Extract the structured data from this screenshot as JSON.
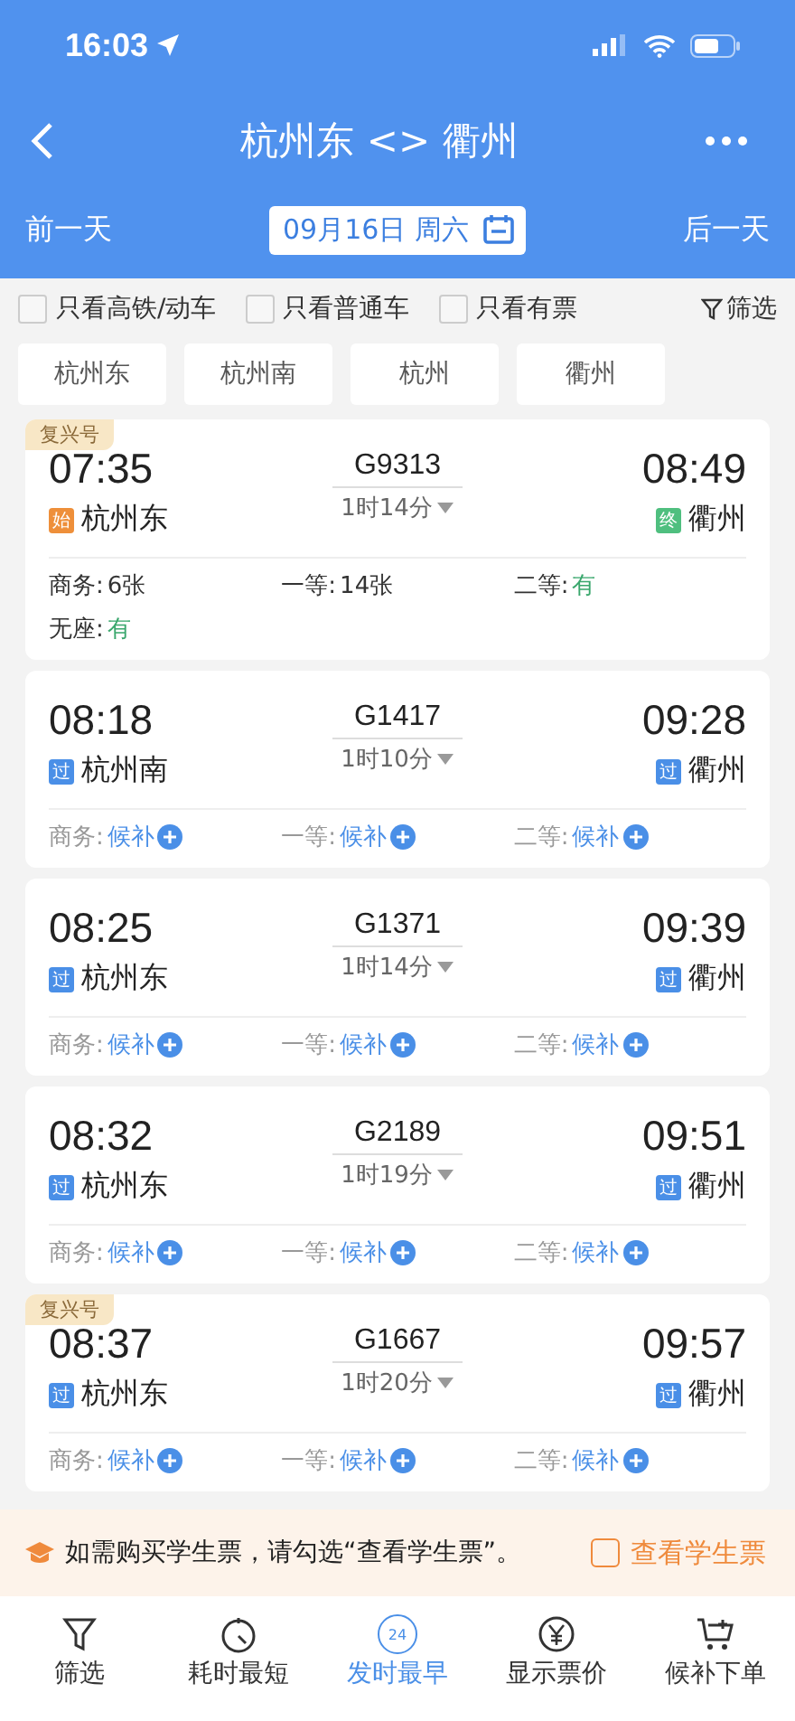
{
  "status_bar": {
    "time": "16:03"
  },
  "nav": {
    "title": "杭州东 <> 衢州"
  },
  "date_bar": {
    "prev": "前一天",
    "date": "09月16日 周六",
    "next": "后一天"
  },
  "filters": [
    {
      "label": "只看高铁/动车",
      "checked": false
    },
    {
      "label": "只看普通车",
      "checked": false
    },
    {
      "label": "只看有票",
      "checked": false
    }
  ],
  "filter_button": "筛选",
  "stations": [
    {
      "label": "杭州东",
      "selected": false
    },
    {
      "label": "杭州南",
      "selected": false
    },
    {
      "label": "杭州",
      "selected": false
    },
    {
      "label": "衢州",
      "selected": false
    }
  ],
  "trains": [
    {
      "tag": "复兴号",
      "depart": "07:35",
      "arrive": "08:49",
      "number": "G9313",
      "duration": "1时14分",
      "from": {
        "badge": "始",
        "kind": "start",
        "name": "杭州东"
      },
      "to": {
        "badge": "终",
        "kind": "end",
        "name": "衢州"
      },
      "seats": [
        {
          "label": "商务:",
          "value": "6张",
          "kind": "count"
        },
        {
          "label": "一等:",
          "value": "14张",
          "kind": "count"
        },
        {
          "label": "二等:",
          "value": "有",
          "kind": "available"
        },
        {
          "label": "无座:",
          "value": "有",
          "kind": "available"
        }
      ]
    },
    {
      "depart": "08:18",
      "arrive": "09:28",
      "number": "G1417",
      "duration": "1时10分",
      "from": {
        "badge": "过",
        "kind": "pass",
        "name": "杭州南"
      },
      "to": {
        "badge": "过",
        "kind": "pass",
        "name": "衢州"
      },
      "seats": [
        {
          "label": "商务:",
          "value": "候补",
          "kind": "waitlist"
        },
        {
          "label": "一等:",
          "value": "候补",
          "kind": "waitlist"
        },
        {
          "label": "二等:",
          "value": "候补",
          "kind": "waitlist"
        }
      ]
    },
    {
      "depart": "08:25",
      "arrive": "09:39",
      "number": "G1371",
      "duration": "1时14分",
      "from": {
        "badge": "过",
        "kind": "pass",
        "name": "杭州东"
      },
      "to": {
        "badge": "过",
        "kind": "pass",
        "name": "衢州"
      },
      "seats": [
        {
          "label": "商务:",
          "value": "候补",
          "kind": "waitlist"
        },
        {
          "label": "一等:",
          "value": "候补",
          "kind": "waitlist"
        },
        {
          "label": "二等:",
          "value": "候补",
          "kind": "waitlist"
        }
      ]
    },
    {
      "depart": "08:32",
      "arrive": "09:51",
      "number": "G2189",
      "duration": "1时19分",
      "from": {
        "badge": "过",
        "kind": "pass",
        "name": "杭州东"
      },
      "to": {
        "badge": "过",
        "kind": "pass",
        "name": "衢州"
      },
      "seats": [
        {
          "label": "商务:",
          "value": "候补",
          "kind": "waitlist"
        },
        {
          "label": "一等:",
          "value": "候补",
          "kind": "waitlist"
        },
        {
          "label": "二等:",
          "value": "候补",
          "kind": "waitlist"
        }
      ]
    },
    {
      "tag": "复兴号",
      "depart": "08:37",
      "arrive": "09:57",
      "number": "G1667",
      "duration": "1时20分",
      "from": {
        "badge": "过",
        "kind": "pass",
        "name": "杭州东"
      },
      "to": {
        "badge": "过",
        "kind": "pass",
        "name": "衢州"
      },
      "seats": [
        {
          "label": "商务:",
          "value": "候补",
          "kind": "waitlist"
        },
        {
          "label": "一等:",
          "value": "候补",
          "kind": "waitlist"
        },
        {
          "label": "二等:",
          "value": "候补",
          "kind": "waitlist"
        }
      ]
    }
  ],
  "student_banner": {
    "text": "如需购买学生票，请勾选“查看学生票”。",
    "option": {
      "label": "查看学生票",
      "checked": false
    }
  },
  "bottom_tabs": [
    {
      "label": "筛选",
      "kind": "filter",
      "selected": false
    },
    {
      "label": "耗时最短",
      "kind": "timer",
      "selected": false
    },
    {
      "label": "发时最早",
      "kind": "clock",
      "icon_text": "24",
      "selected": true
    },
    {
      "label": "显示票价",
      "kind": "price",
      "selected": false
    },
    {
      "label": "候补下单",
      "kind": "cart",
      "selected": false
    }
  ]
}
